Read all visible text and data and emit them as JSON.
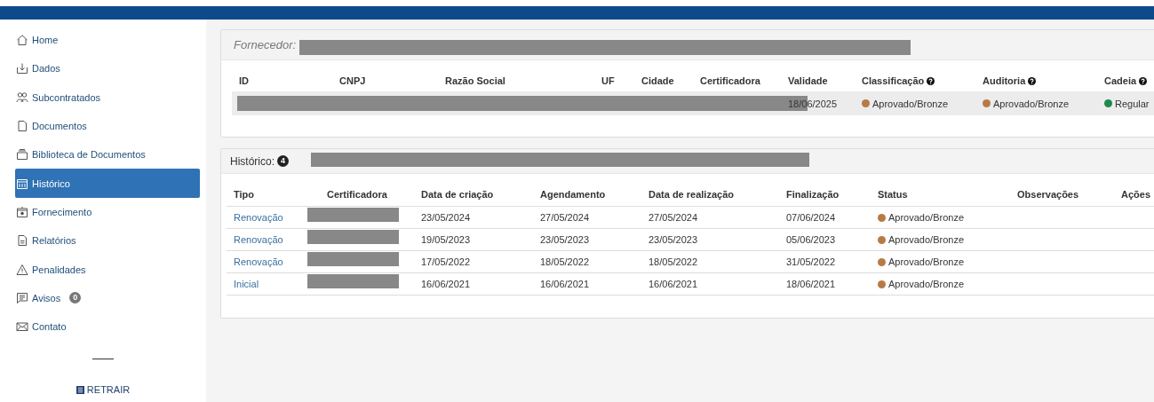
{
  "sidebar": {
    "items": [
      {
        "label": "Home",
        "selected": false
      },
      {
        "label": "Dados",
        "selected": false
      },
      {
        "label": "Subcontratados",
        "selected": false
      },
      {
        "label": "Documentos",
        "selected": false
      },
      {
        "label": "Biblioteca de Documentos",
        "selected": false
      },
      {
        "label": "Histórico",
        "selected": true
      },
      {
        "label": "Fornecimento",
        "selected": false
      },
      {
        "label": "Relatórios",
        "selected": false
      },
      {
        "label": "Penalidades",
        "selected": false
      },
      {
        "label": "Avisos",
        "selected": false,
        "badge": "0"
      },
      {
        "label": "Contato",
        "selected": false
      }
    ],
    "collapse_button": "RETRAIR"
  },
  "supplier_panel": {
    "label": "Fornecedor:",
    "columns": [
      {
        "label": "ID",
        "help": false
      },
      {
        "label": "CNPJ",
        "help": false
      },
      {
        "label": "Razão Social",
        "help": false
      },
      {
        "label": "UF",
        "help": false
      },
      {
        "label": "Cidade",
        "help": false
      },
      {
        "label": "Certificadora",
        "help": false
      },
      {
        "label": "Validade",
        "help": false
      },
      {
        "label": "Classificação",
        "help": true
      },
      {
        "label": "Auditoria",
        "help": true
      },
      {
        "label": "Cadeia",
        "help": true
      }
    ],
    "rows": [
      {
        "validade": "18/06/2025",
        "classificacao": {
          "text": "Aprovado/Bronze",
          "color": "#b87a45"
        },
        "auditoria": {
          "text": "Aprovado/Bronze",
          "color": "#b87a45"
        },
        "cadeia": {
          "text": "Regular",
          "color": "#1e8a4a"
        }
      }
    ]
  },
  "history_panel": {
    "label": "Histórico:",
    "count": "4",
    "columns": [
      "Tipo",
      "Certificadora",
      "Data de criação",
      "Agendamento",
      "Data de realização",
      "Finalização",
      "Status",
      "Observações",
      "Ações"
    ],
    "rows": [
      {
        "tipo": "Renovação",
        "data_criacao": "23/05/2024",
        "agendamento": "27/05/2024",
        "data_realizacao": "27/05/2024",
        "finalizacao": "07/06/2024",
        "status": {
          "text": "Aprovado/Bronze",
          "color": "#b87a45"
        }
      },
      {
        "tipo": "Renovação",
        "data_criacao": "19/05/2023",
        "agendamento": "23/05/2023",
        "data_realizacao": "23/05/2023",
        "finalizacao": "05/06/2023",
        "status": {
          "text": "Aprovado/Bronze",
          "color": "#b87a45"
        }
      },
      {
        "tipo": "Renovação",
        "data_criacao": "17/05/2022",
        "agendamento": "18/05/2022",
        "data_realizacao": "18/05/2022",
        "finalizacao": "31/05/2022",
        "status": {
          "text": "Aprovado/Bronze",
          "color": "#b87a45"
        }
      },
      {
        "tipo": "Inicial",
        "data_criacao": "16/06/2021",
        "agendamento": "16/06/2021",
        "data_realizacao": "16/06/2021",
        "finalizacao": "18/06/2021",
        "status": {
          "text": "Aprovado/Bronze",
          "color": "#b87a45"
        }
      }
    ]
  }
}
